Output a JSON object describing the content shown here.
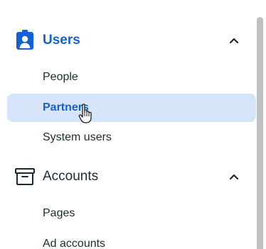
{
  "sidebar": {
    "sections": [
      {
        "label": "Users",
        "icon": "user-badge-icon",
        "expanded": true,
        "items": [
          {
            "label": "People",
            "selected": false
          },
          {
            "label": "Partners",
            "selected": true
          },
          {
            "label": "System users",
            "selected": false
          }
        ]
      },
      {
        "label": "Accounts",
        "icon": "archive-box-icon",
        "expanded": true,
        "items": [
          {
            "label": "Pages",
            "selected": false
          },
          {
            "label": "Ad accounts",
            "selected": false
          }
        ]
      }
    ]
  },
  "colors": {
    "accent": "#1261d6",
    "selected_bg": "#d7e5fa",
    "text": "#1c2b33",
    "scrollbar": "#bcc0c4"
  }
}
